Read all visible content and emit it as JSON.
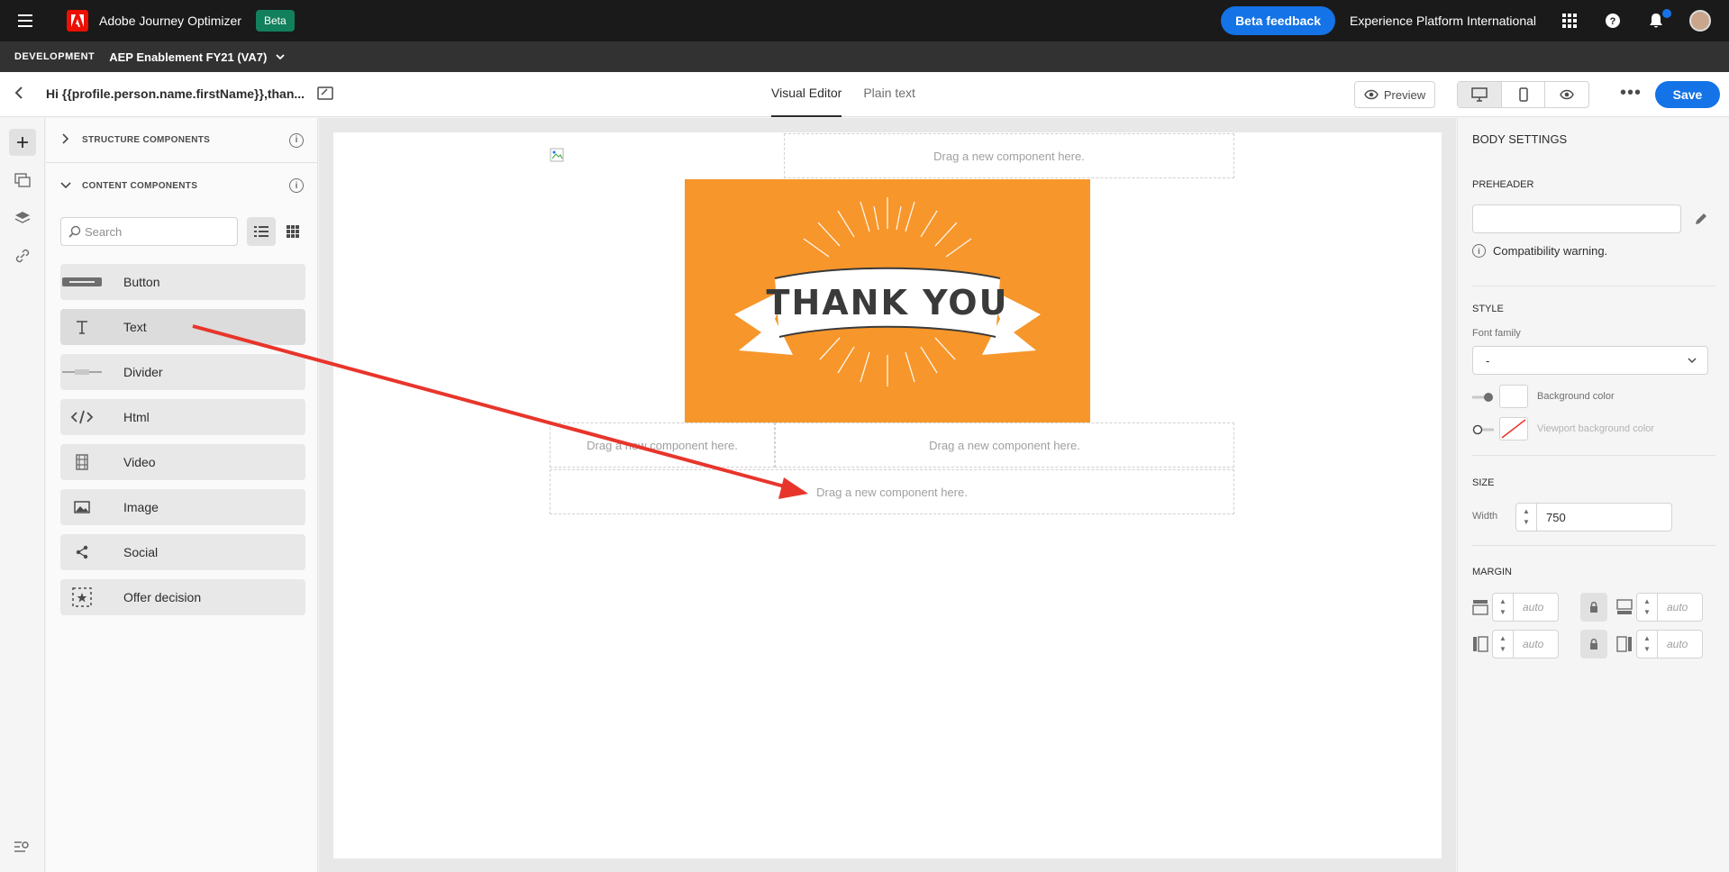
{
  "topbar": {
    "app_name": "Adobe Journey Optimizer",
    "beta_badge": "Beta",
    "beta_feedback": "Beta feedback",
    "org_name": "Experience Platform International"
  },
  "envbar": {
    "env_label": "DEVELOPMENT",
    "sandbox": "AEP Enablement FY21 (VA7)"
  },
  "editor": {
    "message_title": "Hi {{profile.person.name.firstName}},than...",
    "tabs": [
      {
        "label": "Visual Editor",
        "active": true
      },
      {
        "label": "Plain text",
        "active": false
      }
    ],
    "preview_label": "Preview",
    "save_label": "Save"
  },
  "components_panel": {
    "structure_heading": "STRUCTURE COMPONENTS",
    "content_heading": "CONTENT COMPONENTS",
    "search_placeholder": "Search",
    "items": [
      {
        "label": "Button",
        "icon": "button-icon"
      },
      {
        "label": "Text",
        "icon": "text-icon"
      },
      {
        "label": "Divider",
        "icon": "divider-icon"
      },
      {
        "label": "Html",
        "icon": "code-icon"
      },
      {
        "label": "Video",
        "icon": "film-icon"
      },
      {
        "label": "Image",
        "icon": "image-icon"
      },
      {
        "label": "Social",
        "icon": "share-icon"
      },
      {
        "label": "Offer decision",
        "icon": "offer-icon"
      }
    ]
  },
  "canvas": {
    "dropzone_text": "Drag a new component here.",
    "hero_text": "THANK YOU",
    "hero_color": "#f7962b"
  },
  "body_settings": {
    "title": "BODY SETTINGS",
    "preheader_label": "PREHEADER",
    "preheader_value": "",
    "compat_warning": "Compatibility warning.",
    "style_label": "STYLE",
    "font_family_label": "Font family",
    "font_family_value": "-",
    "background_color_label": "Background color",
    "viewport_bg_label": "Viewport background color",
    "size_label": "SIZE",
    "width_label": "Width",
    "width_value": "750",
    "margin_label": "MARGIN",
    "margin_values": [
      "auto",
      "auto",
      "auto",
      "auto"
    ]
  },
  "colors": {
    "accent": "#1473e6",
    "beta_green": "#12805c",
    "adobe_red": "#eb1000",
    "annotation_arrow": "#e8352b"
  }
}
